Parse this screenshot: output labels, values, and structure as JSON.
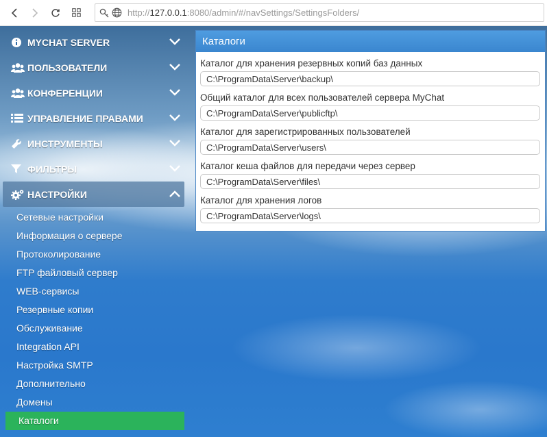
{
  "browser": {
    "url_prefix": "http://",
    "url_host": "127.0.0.1",
    "url_rest": ":8080/admin/#/navSettings/SettingsFolders/"
  },
  "sidebar": {
    "menu": [
      {
        "label": "MYCHAT SERVER",
        "icon": "info-circle-icon"
      },
      {
        "label": "ПОЛЬЗОВАТЕЛИ",
        "icon": "users-icon"
      },
      {
        "label": "КОНФЕРЕНЦИИ",
        "icon": "conference-icon"
      },
      {
        "label": "УПРАВЛЕНИЕ ПРАВАМИ",
        "icon": "list-icon"
      },
      {
        "label": "ИНСТРУМЕНТЫ",
        "icon": "wrench-icon"
      },
      {
        "label": "ФИЛЬТРЫ",
        "icon": "filter-icon"
      },
      {
        "label": "НАСТРОЙКИ",
        "icon": "gears-icon"
      }
    ],
    "settings_items": [
      "Сетевые настройки",
      "Информация о сервере",
      "Протоколирование",
      "FTP файловый сервер",
      "WEB-сервисы",
      "Резервные копии",
      "Обслуживание",
      "Integration API",
      "Настройка SMTP",
      "Дополнительно",
      "Домены",
      "Каталоги"
    ]
  },
  "panel": {
    "title": "Каталоги",
    "fields": [
      {
        "label": "Каталог для хранения резервных копий баз данных",
        "value": "C:\\ProgramData\\Server\\backup\\"
      },
      {
        "label": "Общий каталог для всех пользователей сервера MyChat",
        "value": "C:\\ProgramData\\Server\\publicftp\\"
      },
      {
        "label": "Каталог для зарегистрированных пользователей",
        "value": "C:\\ProgramData\\Server\\users\\"
      },
      {
        "label": "Каталог кеша файлов для передачи через сервер",
        "value": "C:\\ProgramData\\Server\\files\\"
      },
      {
        "label": "Каталог для хранения логов",
        "value": "C:\\ProgramData\\Server\\logs\\"
      }
    ]
  },
  "colors": {
    "accent": "#3a86cf",
    "selected": "#2bb35b"
  }
}
